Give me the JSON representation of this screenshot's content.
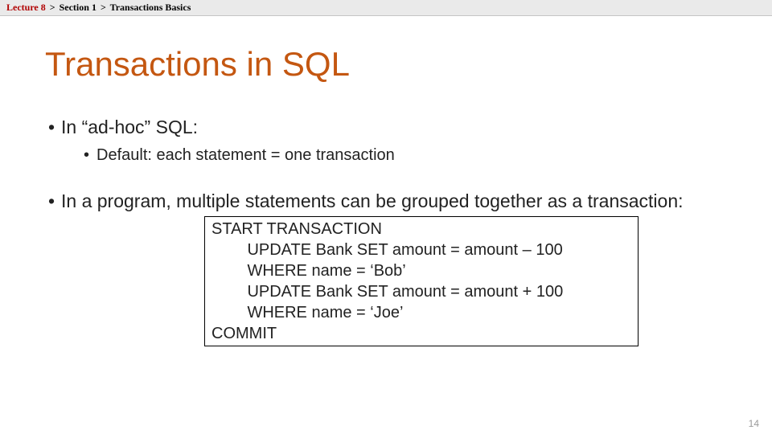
{
  "breadcrumb": {
    "items": [
      "Lecture 8",
      "Section 1",
      "Transactions Basics"
    ],
    "sep": ">"
  },
  "title": "Transactions in SQL",
  "bullets": {
    "b1": "In “ad-hoc” SQL:",
    "b1_sub1": "Default: each statement = one transaction",
    "b2": "In a program, multiple statements can be grouped together as a transaction:"
  },
  "code": "START TRANSACTION\n        UPDATE Bank SET amount = amount – 100\n        WHERE name = ‘Bob’\n        UPDATE Bank SET amount = amount + 100\n        WHERE name = ‘Joe’\nCOMMIT",
  "page_number": "14"
}
